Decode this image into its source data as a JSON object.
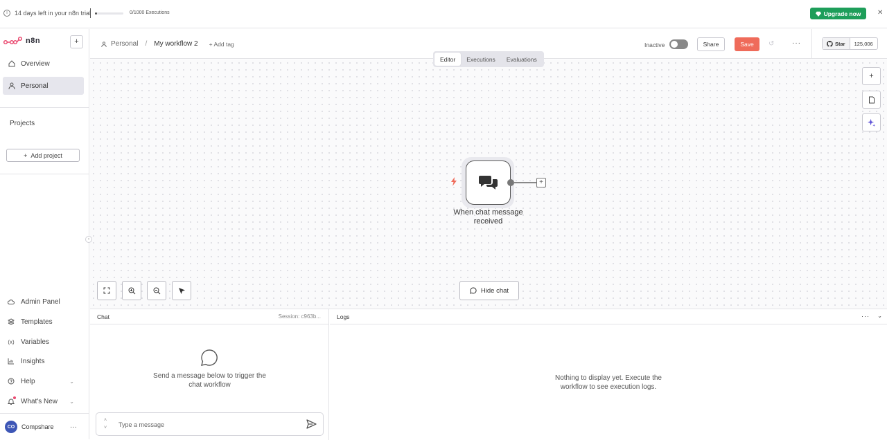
{
  "banner": {
    "trial_text": "14 days left in your n8n trial",
    "executions_text": "0/1000 Executions",
    "executions_used": 0,
    "executions_limit": 1000,
    "upgrade_label": "Upgrade now",
    "upgrade_color": "#1e9e5a"
  },
  "sidebar": {
    "logo_text": "n8n",
    "overview_label": "Overview",
    "personal_label": "Personal",
    "projects_heading": "Projects",
    "add_project_label": "Add project",
    "bottom_items": [
      "Admin Panel",
      "Templates",
      "Variables",
      "Insights",
      "Help",
      "What's New"
    ],
    "user_initials": "CO",
    "user_name": "Compshare"
  },
  "header": {
    "breadcrumb_project": "Personal",
    "workflow_name": "My workflow 2",
    "add_tag_label": "+ Add tag",
    "status_label": "Inactive",
    "share_label": "Share",
    "save_label": "Save",
    "save_color": "#ef6b5a",
    "github_star_label": "Star",
    "github_star_count": "125,006"
  },
  "tabs": [
    "Editor",
    "Executions",
    "Evaluations"
  ],
  "active_tab": "Editor",
  "canvas": {
    "node_label": "When chat message received",
    "hide_chat_label": "Hide chat"
  },
  "chat": {
    "title": "Chat",
    "session": "Session: c963b...",
    "empty_text": "Send a message below to trigger the chat workflow",
    "input_placeholder": "Type a message"
  },
  "logs": {
    "title": "Logs",
    "empty_text": "Nothing to display yet. Execute the workflow to see execution logs."
  }
}
